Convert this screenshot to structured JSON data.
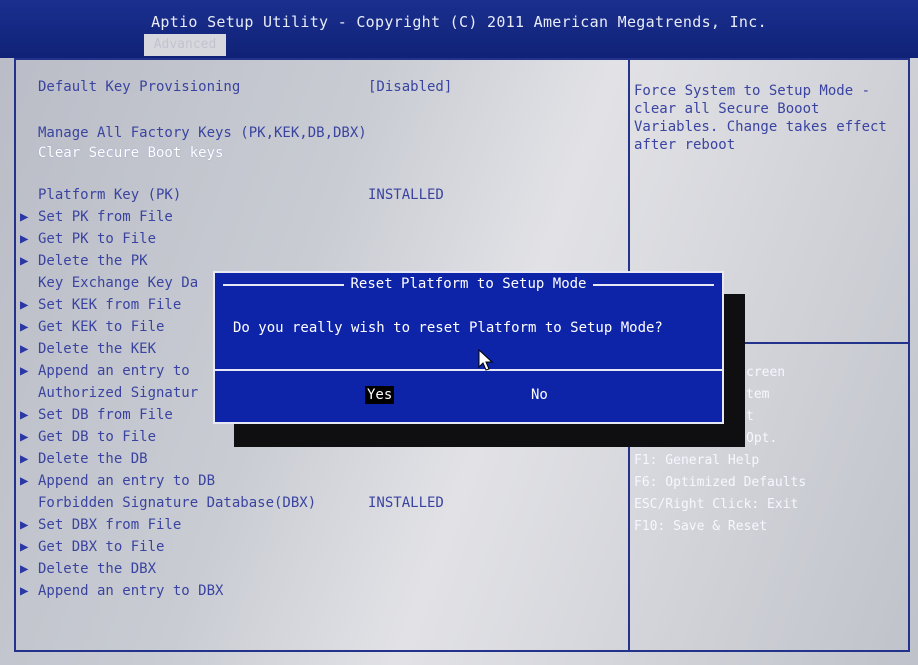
{
  "header": {
    "title": "Aptio Setup Utility - Copyright (C) 2011 American Megatrends, Inc.",
    "tab": "Advanced"
  },
  "menu": {
    "default_key_provisioning": {
      "label": "Default Key Provisioning",
      "value": "[Disabled]"
    },
    "manage_keys": "Manage All Factory Keys (PK,KEK,DB,DBX)",
    "clear_keys": "Clear Secure Boot keys",
    "platform_key": {
      "label": "Platform Key (PK)",
      "value": "INSTALLED"
    },
    "set_pk": "Set PK from File",
    "get_pk": "Get PK to File",
    "delete_pk": "Delete the PK",
    "kek_db": "Key Exchange Key Da",
    "set_kek": "Set KEK from File",
    "get_kek": "Get KEK to File",
    "delete_kek": "Delete the KEK",
    "append_kek": "Append an entry to",
    "auth_sig": "Authorized Signatur",
    "set_db": "Set DB from File",
    "get_db": "Get DB to File",
    "delete_db": "Delete the DB",
    "append_db": "Append an entry to DB",
    "forbidden_db": {
      "label": "Forbidden Signature Database(DBX)",
      "value": "INSTALLED"
    },
    "set_dbx": "Set DBX from File",
    "get_dbx": "Get DBX to File",
    "delete_dbx": "Delete the DBX",
    "append_dbx": "Append an entry to DBX"
  },
  "help": {
    "text": "Force System to Setup Mode -\nclear all Secure Booot\nVariables. Change takes effect\nafter reboot"
  },
  "keys": {
    "k1": "creen",
    "k2": "tem",
    "k3": "t",
    "k4": "Opt.",
    "k5": "F1: General Help",
    "k6": "F6: Optimized Defaults",
    "k7": "ESC/Right Click: Exit",
    "k8": "F10: Save & Reset"
  },
  "dialog": {
    "title": "Reset Platform to Setup Mode",
    "message": "Do you really wish to reset Platform to Setup Mode?",
    "yes": "Yes",
    "no": "No"
  },
  "colors": {
    "header_bg": "#1a2f8f",
    "dialog_bg": "#0d24a8",
    "text_blue": "#3a44a0",
    "frame": "#23338b"
  }
}
